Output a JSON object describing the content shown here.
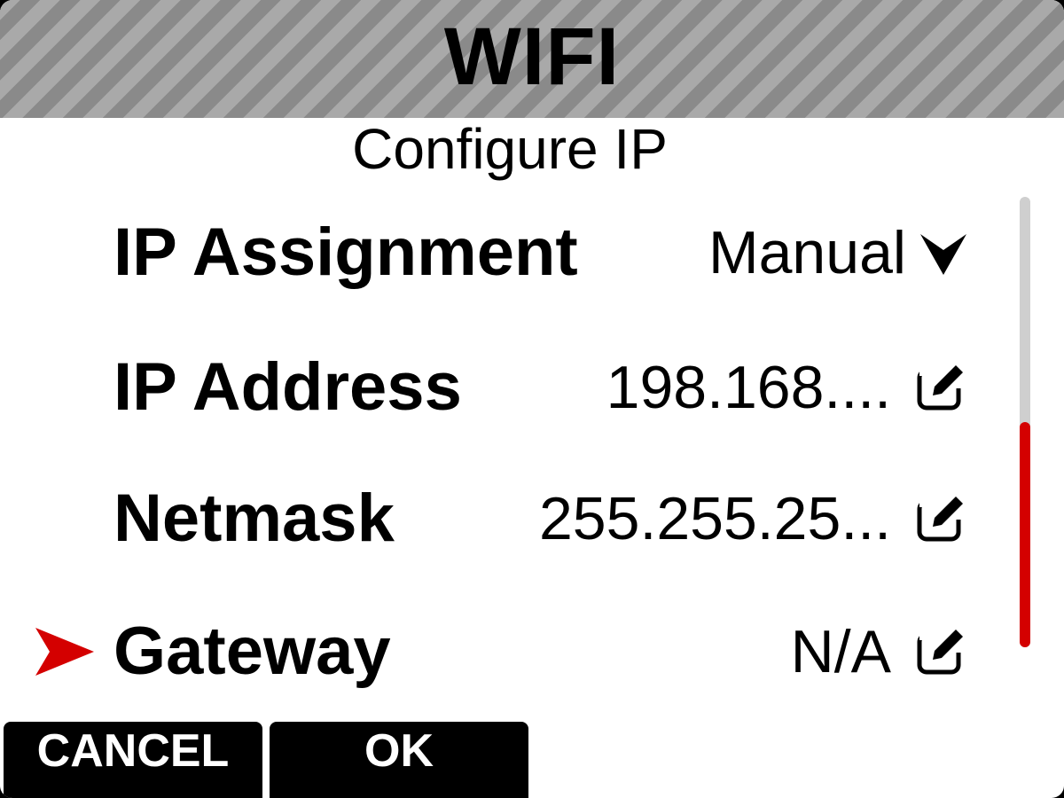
{
  "header": {
    "title": "WIFI"
  },
  "subtitle": "Configure IP",
  "rows": [
    {
      "label": "IP Assignment",
      "value": "Manual",
      "icon": "chevron-down-icon",
      "selected": false
    },
    {
      "label": "IP Address",
      "value": "198.168....",
      "icon": "edit-icon",
      "selected": false
    },
    {
      "label": "Netmask",
      "value": "255.255.25...",
      "icon": "edit-icon",
      "selected": false
    },
    {
      "label": "Gateway",
      "value": "N/A",
      "icon": "edit-icon",
      "selected": true
    }
  ],
  "scrollbar": {
    "position_fraction": 0.5,
    "visible_fraction": 0.5
  },
  "buttons": {
    "cancel_label": "CANCEL",
    "ok_label": "OK"
  },
  "colors": {
    "accent": "#d40000",
    "header_stripe_light": "#a9a9a9",
    "header_stripe_dark": "#8a8a8a",
    "button_bg": "#000000",
    "button_text": "#ffffff"
  }
}
